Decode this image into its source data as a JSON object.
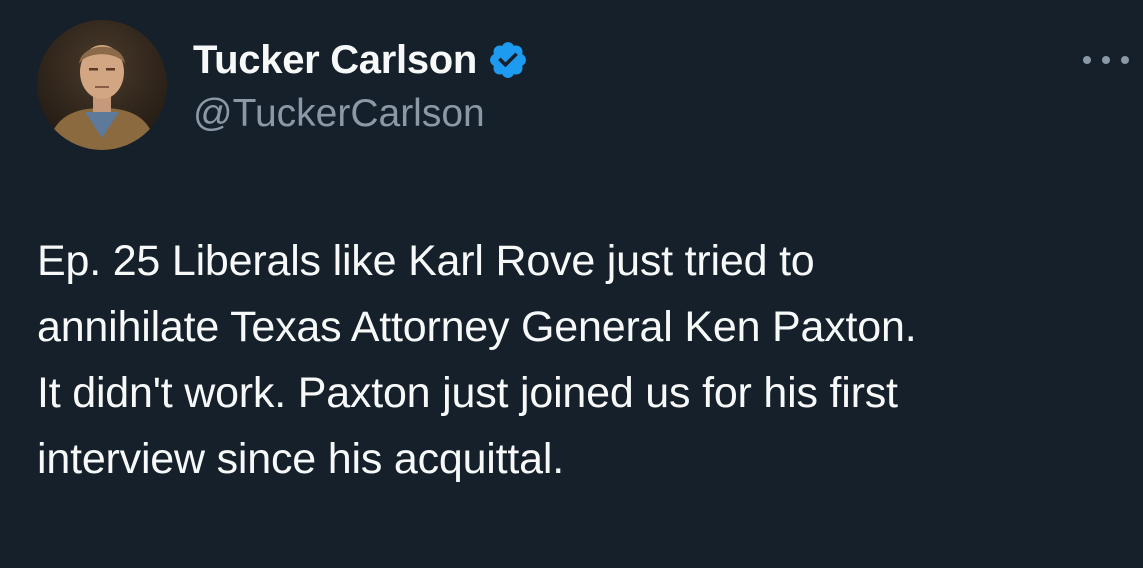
{
  "author": {
    "display_name": "Tucker Carlson",
    "handle": "@TuckerCarlson",
    "verified": true,
    "verified_color": "#1d9bf0"
  },
  "tweet": {
    "text": "Ep. 25  Liberals like Karl Rove just tried to\nannihilate Texas Attorney General Ken Paxton.\nIt didn't work. Paxton just joined us for his first\ninterview since his acquittal."
  },
  "icons": {
    "more": "more-options-icon",
    "verified": "verified-badge-icon"
  },
  "colors": {
    "background": "#15202b",
    "text_primary": "#f7f9f9",
    "text_secondary": "#8b98a5"
  }
}
